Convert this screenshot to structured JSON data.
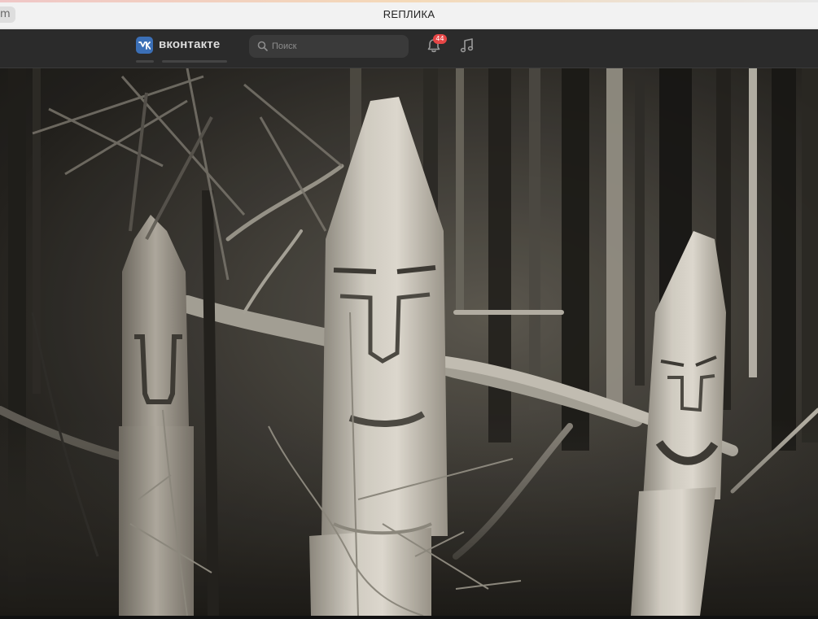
{
  "browser": {
    "tab_fragment": "m",
    "page_heading": "REПЛИКА"
  },
  "vk_header": {
    "logo_glyph": "VK",
    "wordmark": "вконтакте",
    "search": {
      "placeholder": "Поиск"
    },
    "notifications": {
      "badge_count": "44"
    },
    "accent_color": "#3b6fb6",
    "badge_color": "#e64646",
    "icons": [
      "vk-logo-icon",
      "search-icon",
      "bell-icon",
      "music-note-icon"
    ]
  }
}
